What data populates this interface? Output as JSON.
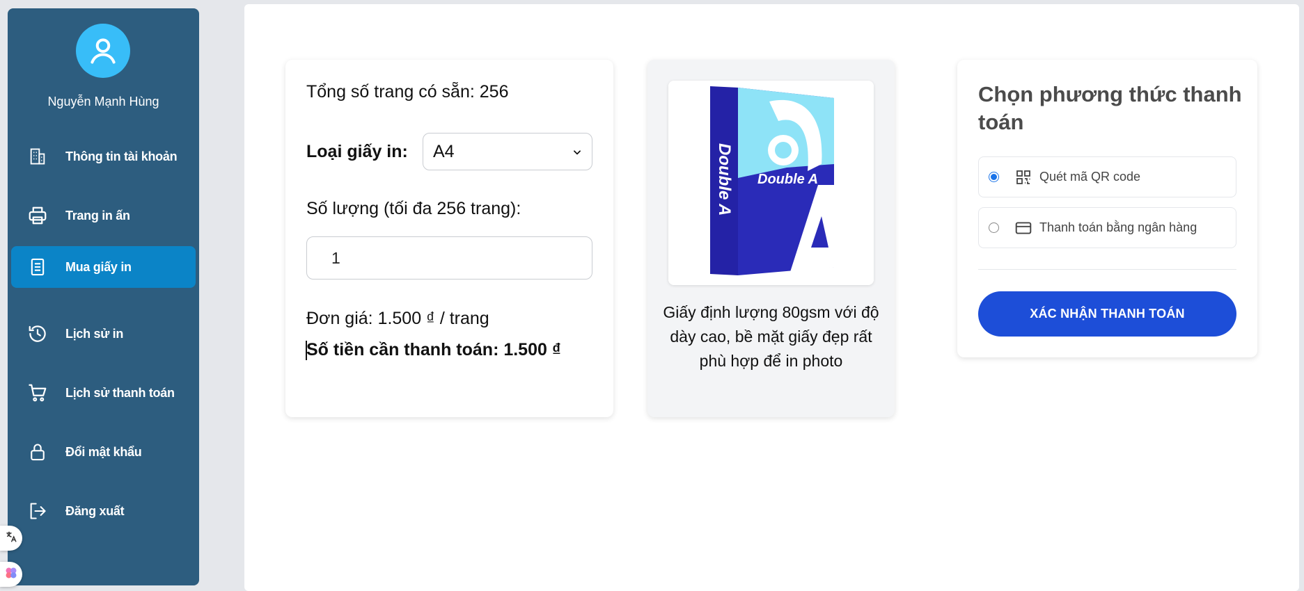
{
  "user": {
    "name": "Nguyễn Mạnh Hùng"
  },
  "sidebar": {
    "items": [
      {
        "label": "Thông tin tài khoản",
        "icon": "building-icon",
        "active": false
      },
      {
        "label": "Trang in ấn",
        "icon": "printer-icon",
        "active": false
      },
      {
        "label": "Mua giấy in",
        "icon": "document-icon",
        "active": true
      },
      {
        "label": "Lịch sử in",
        "icon": "history-icon",
        "active": false
      },
      {
        "label": "Lịch sử thanh toán",
        "icon": "cart-icon",
        "active": false
      },
      {
        "label": "Đổi mật khẩu",
        "icon": "lock-icon",
        "active": false
      },
      {
        "label": "Đăng xuất",
        "icon": "logout-icon",
        "active": false
      }
    ]
  },
  "purchase": {
    "total_pages": "Tổng số trang có sẵn: 256",
    "paper_type_label": "Loại giấy in:",
    "paper_type_value": "A4",
    "quantity_label": "Số lượng (tối đa 256 trang):",
    "quantity_value": "1",
    "unit_price": "Đơn giá: 1.500 ₫ / trang",
    "total_payment": "Số tiền cần thanh toán: 1.500 ₫"
  },
  "product": {
    "image_brand": "Double A",
    "description": "Giấy định lượng 80gsm với độ dày cao, bề mặt giấy đẹp rất phù hợp để in photo"
  },
  "payment": {
    "title": "Chọn phương thức thanh toán",
    "options": [
      {
        "label": "Quét mã QR code",
        "icon": "qr-code-icon",
        "selected": true
      },
      {
        "label": "Thanh toán bằng ngân hàng",
        "icon": "credit-card-icon",
        "selected": false
      }
    ],
    "confirm_label": "XÁC NHẬN THANH TOÁN"
  },
  "colors": {
    "sidebar_bg": "#2d5d7f",
    "active_item": "#0b84c7",
    "avatar": "#38bdf8",
    "confirm_button": "#1d4ed8"
  }
}
